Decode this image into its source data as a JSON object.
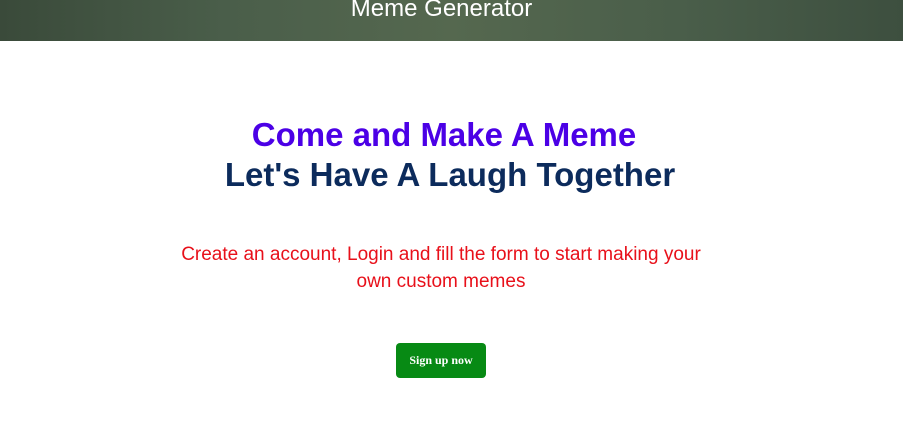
{
  "header": {
    "title": "Meme Generator"
  },
  "hero": {
    "headline_primary": "Come and Make A Meme",
    "headline_secondary": "Let's Have A Laugh Together",
    "description": "Create an account, Login and fill the form to start making your own custom memes",
    "cta_label": "Sign up now"
  },
  "colors": {
    "header_bg": "#4a5e4a",
    "headline_primary": "#4b00e6",
    "headline_secondary": "#0c2b5c",
    "description": "#e8101a",
    "cta_bg": "#078a14"
  }
}
